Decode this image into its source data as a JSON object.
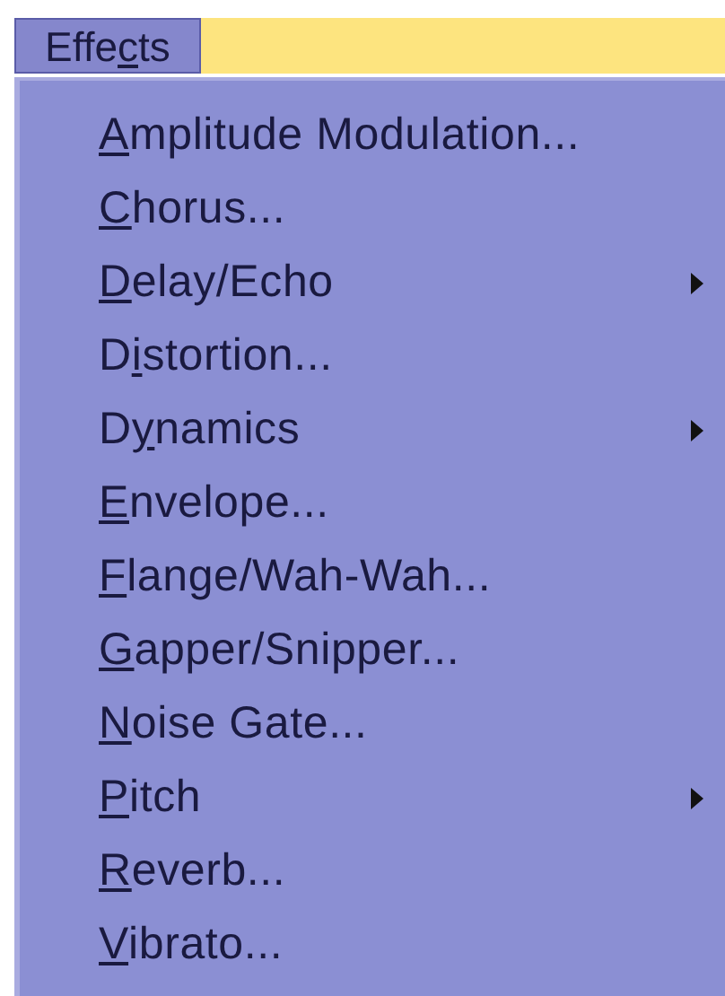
{
  "menu_bar": {
    "title": {
      "pre": "Effe",
      "key": "c",
      "post": "ts"
    },
    "selected": true
  },
  "menu": {
    "items": [
      {
        "key": "A",
        "post": "mplitude Modulation...",
        "submenu": false
      },
      {
        "key": "C",
        "post": "horus...",
        "submenu": false
      },
      {
        "key": "D",
        "post": "elay/Echo",
        "submenu": true
      },
      {
        "pre": "D",
        "key": "i",
        "post": "stortion...",
        "submenu": false
      },
      {
        "pre": "D",
        "key": "y",
        "post": "namics",
        "submenu": true
      },
      {
        "key": "E",
        "post": "nvelope...",
        "submenu": false
      },
      {
        "key": "F",
        "post": "lange/Wah-Wah...",
        "submenu": false
      },
      {
        "key": "G",
        "post": "apper/Snipper...",
        "submenu": false
      },
      {
        "key": "N",
        "post": "oise Gate...",
        "submenu": false
      },
      {
        "key": "P",
        "post": "itch",
        "submenu": true
      },
      {
        "key": "R",
        "post": "everb...",
        "submenu": false
      },
      {
        "key": "V",
        "post": "ibrato...",
        "submenu": false
      }
    ]
  }
}
